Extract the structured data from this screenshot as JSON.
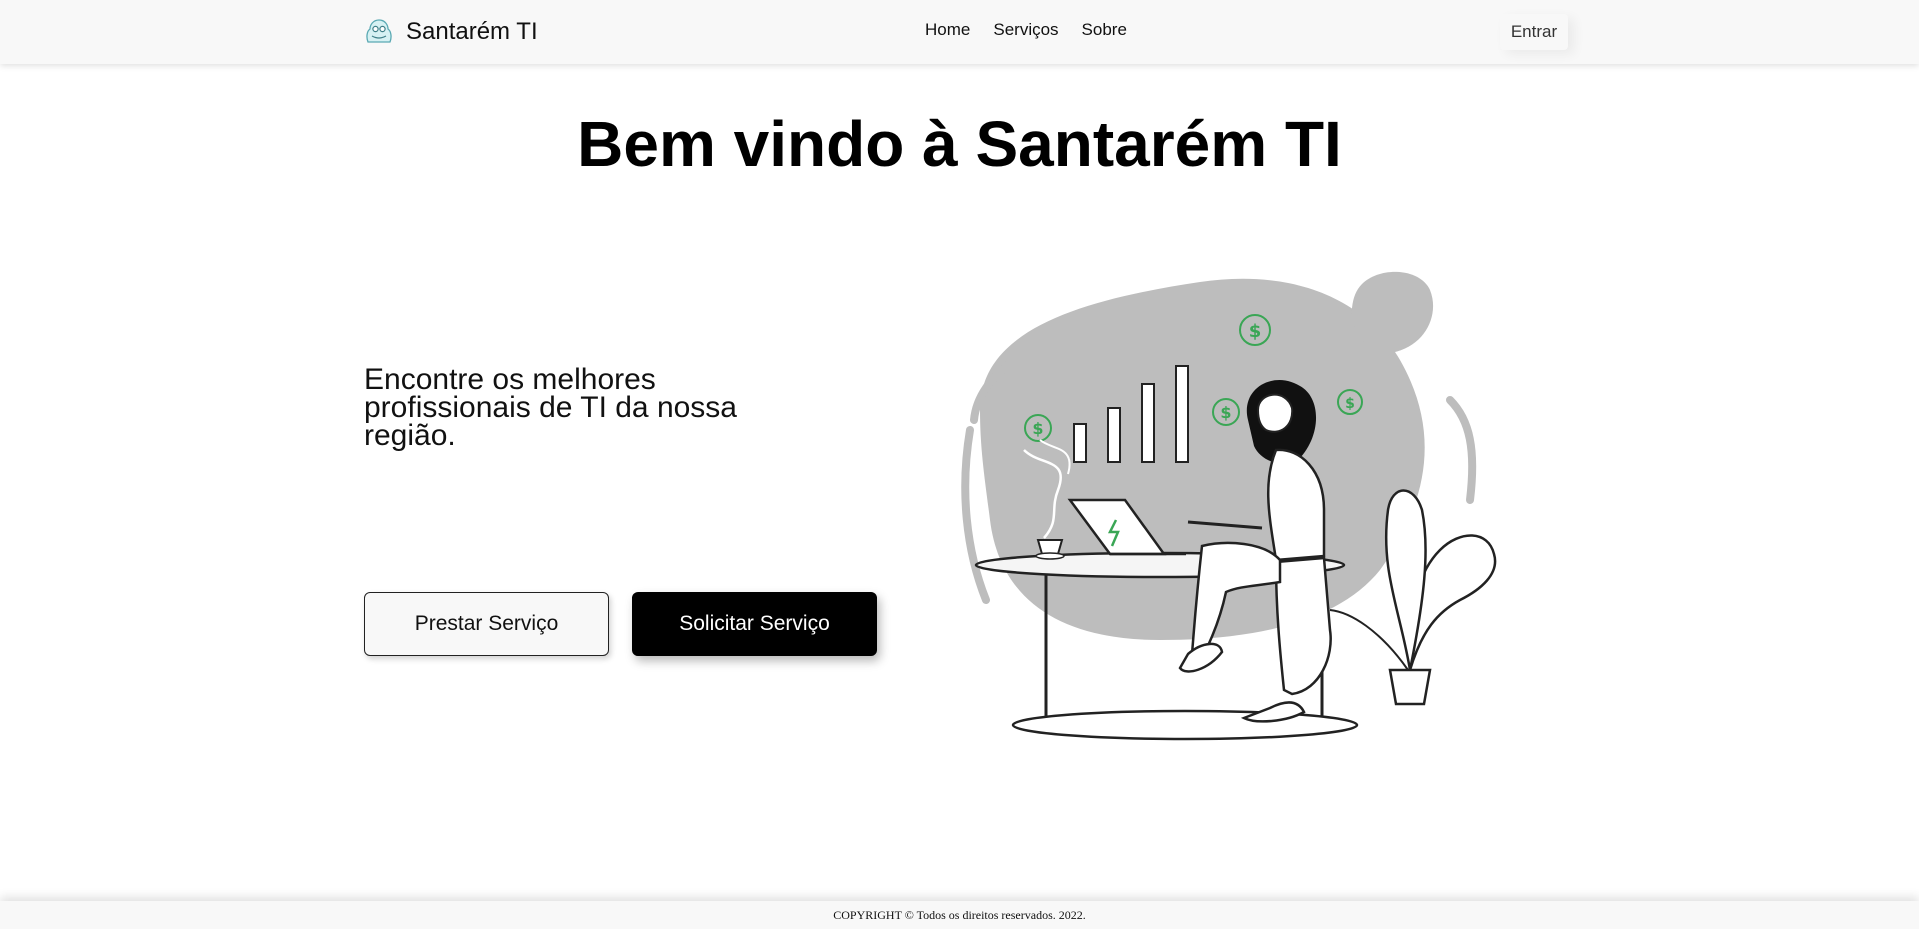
{
  "navbar": {
    "brand_name": "Santarém TI",
    "brand_icon": "brand-logo-icon",
    "links": [
      {
        "label": "Home"
      },
      {
        "label": "Serviços"
      },
      {
        "label": "Sobre"
      }
    ],
    "login_label": "Entrar"
  },
  "hero": {
    "title": "Bem vindo à Santarém TI",
    "tagline": "Encontre os melhores profissionais de TI da nossa região.",
    "buttons": {
      "provide_label": "Prestar Serviço",
      "request_label": "Solicitar Serviço"
    },
    "illustration_icon": "person-working-on-laptop-illustration"
  },
  "footer": {
    "text": "COPYRIGHT © Todos os direitos reservados. 2022."
  },
  "colors": {
    "navbar_bg": "#f8f8f8",
    "primary_button": "#000000",
    "illustration_blob": "#bdbdbd",
    "accent_green": "#3aa655"
  }
}
